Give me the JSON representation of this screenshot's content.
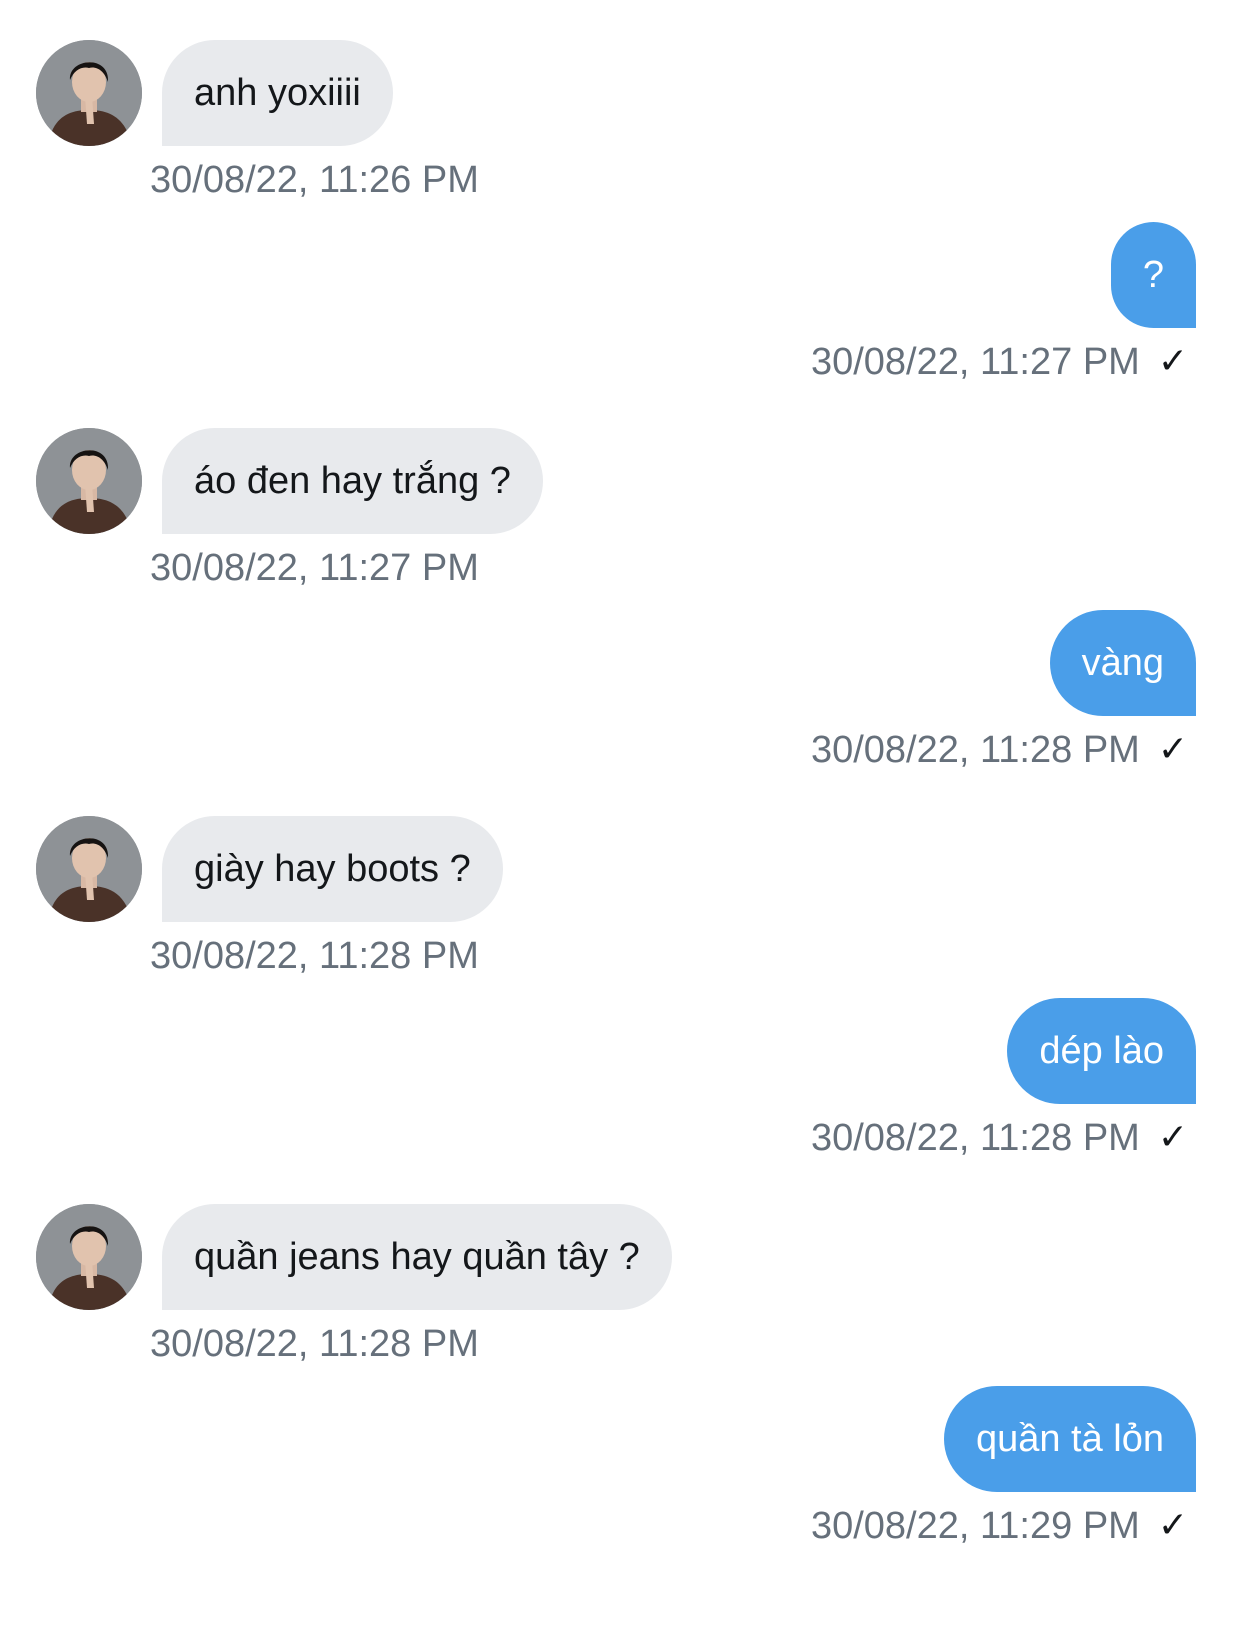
{
  "messages": [
    {
      "direction": "in",
      "text": "anh yoxiiii",
      "time": "30/08/22, 11:26 PM"
    },
    {
      "direction": "out",
      "text": "?",
      "time": "30/08/22, 11:27 PM",
      "receipt_icon": "check-icon"
    },
    {
      "direction": "in",
      "text": "áo đen hay trắng ?",
      "time": "30/08/22, 11:27 PM"
    },
    {
      "direction": "out",
      "text": "vàng",
      "time": "30/08/22, 11:28 PM",
      "receipt_icon": "check-icon"
    },
    {
      "direction": "in",
      "text": "giày hay boots ?",
      "time": "30/08/22, 11:28 PM"
    },
    {
      "direction": "out",
      "text": "dép lào",
      "time": "30/08/22, 11:28 PM",
      "receipt_icon": "check-icon"
    },
    {
      "direction": "in",
      "text": "quần jeans hay quần tây ?",
      "time": "30/08/22, 11:28 PM"
    },
    {
      "direction": "out",
      "text": "quần tà lỏn",
      "time": "30/08/22, 11:29 PM",
      "receipt_icon": "check-icon"
    }
  ],
  "colors": {
    "incoming_bubble": "#e8eaed",
    "outgoing_bubble": "#4a9ee9",
    "timestamp": "#66707b",
    "text_dark": "#14171a"
  },
  "receipt_glyph": "✓"
}
